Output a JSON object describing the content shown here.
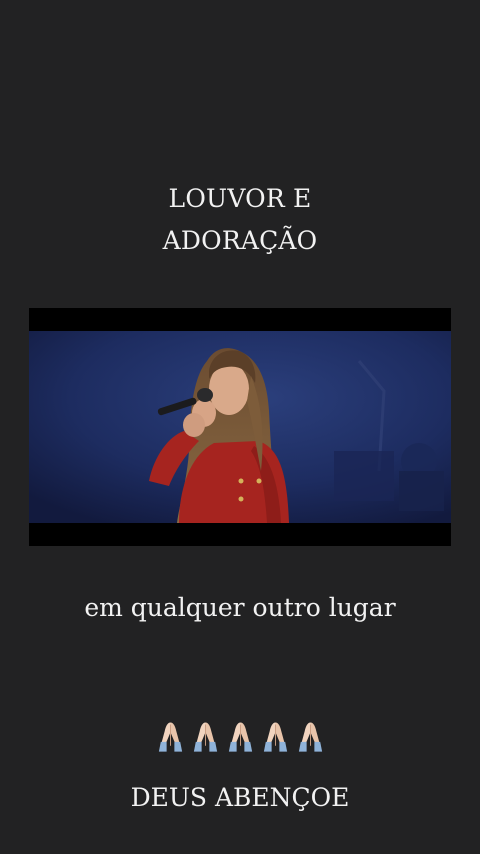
{
  "story": {
    "title_line1": "LOUVOR E",
    "title_line2": "ADORAÇÃO",
    "caption": "em qualquer outro lugar",
    "emoji": {
      "icon": "folded-hands-icon",
      "count": 5,
      "skin_color": "#f1d4bf",
      "sleeve_color": "#8fb3d9"
    },
    "blessing": "DEUS ABENÇOE"
  },
  "colors": {
    "background": "#222223",
    "text": "#f2f2f2",
    "video_letterbox": "#000000",
    "stage_blue": "#1f2f66",
    "jacket_red": "#a6241f"
  }
}
